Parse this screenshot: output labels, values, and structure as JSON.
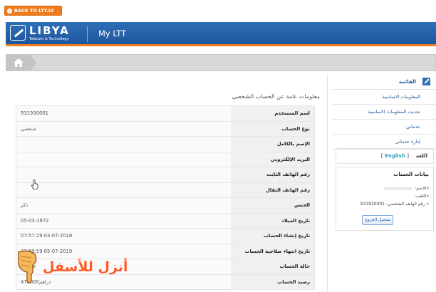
{
  "topbar": {
    "back_label": "BACK TO LTT.LY"
  },
  "header": {
    "logo_text": "LIBYA",
    "logo_sub": "Telecom & Technology",
    "title": "My LTT"
  },
  "main": {
    "section_title": "معلومات عامة عن الحساب الشخصي",
    "rows": [
      {
        "label": "اسم المستخدم",
        "value": "931930001"
      },
      {
        "label": "نوع الحساب",
        "value": "شخصي"
      },
      {
        "label": "الإسم بالكامل",
        "value": ""
      },
      {
        "label": "البريد الإلكتروني",
        "value": ""
      },
      {
        "label": "رقم الهاتف الثابت",
        "value": ""
      },
      {
        "label": "رقم الهاتف النقال",
        "value": ""
      },
      {
        "label": "الجنس",
        "value": "ذكر"
      },
      {
        "label": "تاريخ الميلاد",
        "value": "05-03-1972"
      },
      {
        "label": "تاريخ إنشاء الحساب",
        "value": "07:57:29 03-07-2018"
      },
      {
        "label": "تاريخ انتهاء صلاحية الحساب",
        "value": "23:59:59 05-07-2019"
      },
      {
        "label": "حالة الحساب",
        "value": "Active"
      },
      {
        "label": "رصيد الحساب",
        "value": "475000دراهم"
      }
    ]
  },
  "sidebar": {
    "menu_title": "القائمة",
    "items": [
      {
        "label": "المعلومات الاساسية"
      },
      {
        "label": "تحديث المعلومات الاساسية"
      },
      {
        "label": "خدماتي"
      },
      {
        "label": "إدارة خدماتي"
      }
    ],
    "lang_label": "اللغة",
    "lang_link": "English",
    "account": {
      "title": "بيانات الحساب",
      "name_label": "»الاسم:",
      "title_label": "»اللقب:",
      "phone_label": "» رقم الهاتف الشخصي:",
      "phone_value": "931930001",
      "logout_label": "تسجيل الخروج"
    }
  },
  "overlay": {
    "caption": "أنزل للأسفل"
  },
  "colors": {
    "brand_blue": "#1e56a0",
    "accent_orange": "#f07d1c"
  },
  "icons": [
    "home-icon",
    "menu-icon",
    "cursor-hand-icon",
    "pointing-hand-icon"
  ]
}
